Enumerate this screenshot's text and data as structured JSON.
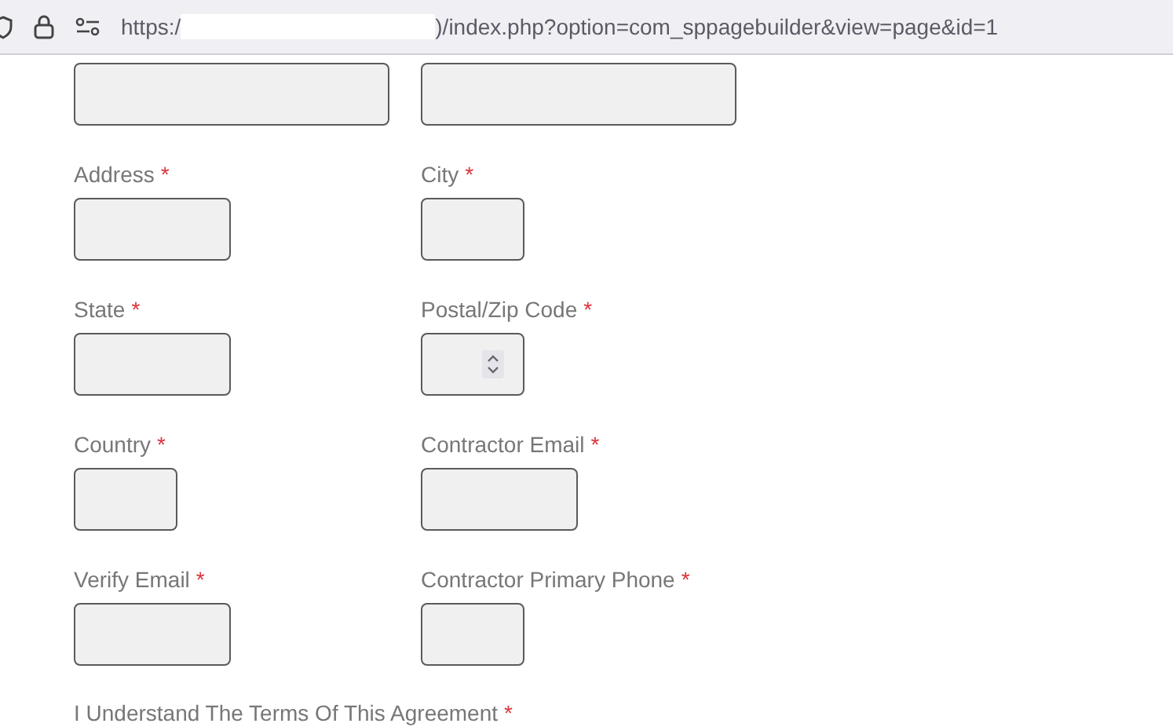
{
  "address_bar": {
    "url_start": "https:/",
    "url_end": ")/index.php?option=com_sppagebuilder&view=page&id=1"
  },
  "form": {
    "fields": [
      {
        "kind": "text"
      },
      {
        "kind": "text"
      },
      {
        "label": "Address",
        "required": true,
        "kind": "text"
      },
      {
        "label": "City",
        "required": true,
        "kind": "text"
      },
      {
        "label": "State",
        "required": true,
        "kind": "text"
      },
      {
        "label": "Postal/Zip Code",
        "required": true,
        "kind": "number"
      },
      {
        "label": "Country",
        "required": true,
        "kind": "text"
      },
      {
        "label": "Contractor Email",
        "required": true,
        "kind": "text"
      },
      {
        "label": "Verify Email",
        "required": true,
        "kind": "text"
      },
      {
        "label": "Contractor Primary Phone",
        "required": true,
        "kind": "text"
      }
    ],
    "agreement": {
      "label": "I Understand The Terms Of This Agreement",
      "required": true
    },
    "required_mark": "*"
  }
}
